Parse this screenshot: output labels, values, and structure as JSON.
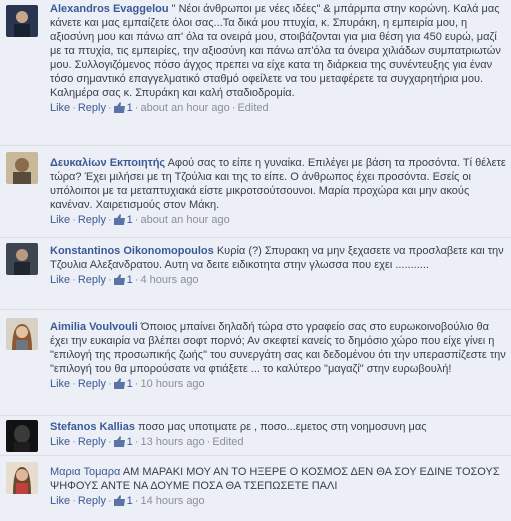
{
  "comments": [
    {
      "author": "Alexandros Evaggelou",
      "text": "\" Νέοι άνθρωποι με νέες ιδέες\" & μπάρμπα στην κορώνη. Καλά μας κάνετε και μας εμπαίζετε όλοι σας...Τα δικά μου πτυχία, κ. Σπυράκη, η εμπειρία μου, η αξιοσύνη μου και πάνω απ' όλα τα ονειρά μου, στοιβάζονται για μια θέση για 450 ευρώ, μαζί με τα πτυχία, τις εμπειρίες, την αξιοσύνη και πάνω απ'όλα τα όνειρα χιλιάδων συμπατριωτών μου. Συλλογιζόμενος πόσο άγχος πρεπει να είχε κατα τη διάρκεια της συνέντευξης για έναν τόσο σημαντικό επαγγελματικό σταθμό οφείλετε να του μεταφέρετε τα συγχαρητήρια μου. Καλημέρα σας κ. Σπυράκη και καλή σταδιοδρομία.",
      "like": "Like",
      "reply": "Reply",
      "likes": "1",
      "time": "about an hour ago",
      "edited": "Edited"
    },
    {
      "author": "Δευκαλίων Εκποιητής",
      "text": "Αφού σας το είπε η γυναίκα. Επιλέγει με βάση τα προσόντα. Τί θέλετε τώρα? Έχει μιλήσει με τη Τζούλια και της το είπε. Ο άνθρωπος έχει προσόντα. Εσείς οι υπόλοιποι με τα μεταπτυχιακά είστε μικροτσούτσουνοι. Μαρία προχώρα και μην ακούς κανέναν. Χαιρετισμούς στον Μάκη.",
      "like": "Like",
      "reply": "Reply",
      "likes": "1",
      "time": "about an hour ago",
      "edited": ""
    },
    {
      "author": "Konstantinos Oikonomopoulos",
      "text": "Κυρία (?) Σπυρακη να μην ξεχασετε να προσλαβετε και την Τζουλια Αλεξανδρατου. Αυτη να δειτε ειδικοτητα στην γλωσσα που εχει ...........",
      "like": "Like",
      "reply": "Reply",
      "likes": "1",
      "time": "4 hours ago",
      "edited": ""
    },
    {
      "author": "Aimilia Voulvouli",
      "text": "Όποιος μπαίνει δηλαδή τώρα στο γραφείο σας στο ευρωκοινοβούλιο θα έχει την ευκαιρία να βλέπει σοφτ πορνό; Αν σκεφτεί κανείς το δημόσιο χώρο που είχε γίνει η \"επιλογή της προσωπικής ζωής\" του συνεργάτη σας και δεδομένου ότι την υπερασπίζεστε την \"επιλογή του θα μπορούσατε να φτιάξετε ... το καλύτερο \"μαγαζί\" στην ευρωβουλή!",
      "like": "Like",
      "reply": "Reply",
      "likes": "1",
      "time": "10 hours ago",
      "edited": ""
    },
    {
      "author": "Stefanos Kallias",
      "text": "ποσο μας υποτιματε ρε , ποσο...εμετος στη νοημοσυνη μας",
      "like": "Like",
      "reply": "Reply",
      "likes": "1",
      "time": "13 hours ago",
      "edited": "Edited"
    },
    {
      "author": "Μαρια Τομαρα",
      "text": "ΑΜ ΜΑΡΑΚΙ ΜΟΥ ΑΝ ΤΟ ΗΞΕΡΕ Ο ΚΟΣΜΟΣ ΔΕΝ ΘΑ ΣΟΥ ΕΔΙΝΕ ΤΟΣΟΥΣ ΨΗΦΟΥΣ ΑΝΤΕ ΝΑ ΔΟΥΜΕ ΠΟΣΑ ΘΑ ΤΣΕΠΩΣΕΤΕ ΠΑΛΙ",
      "like": "Like",
      "reply": "Reply",
      "likes": "1",
      "time": "14 hours ago",
      "edited": ""
    }
  ],
  "colors": {
    "link": "#3b5998",
    "text": "#37404e",
    "meta": "#898f9c",
    "background": "#eceff5"
  },
  "icons": {
    "like": "thumbs-up-icon"
  }
}
